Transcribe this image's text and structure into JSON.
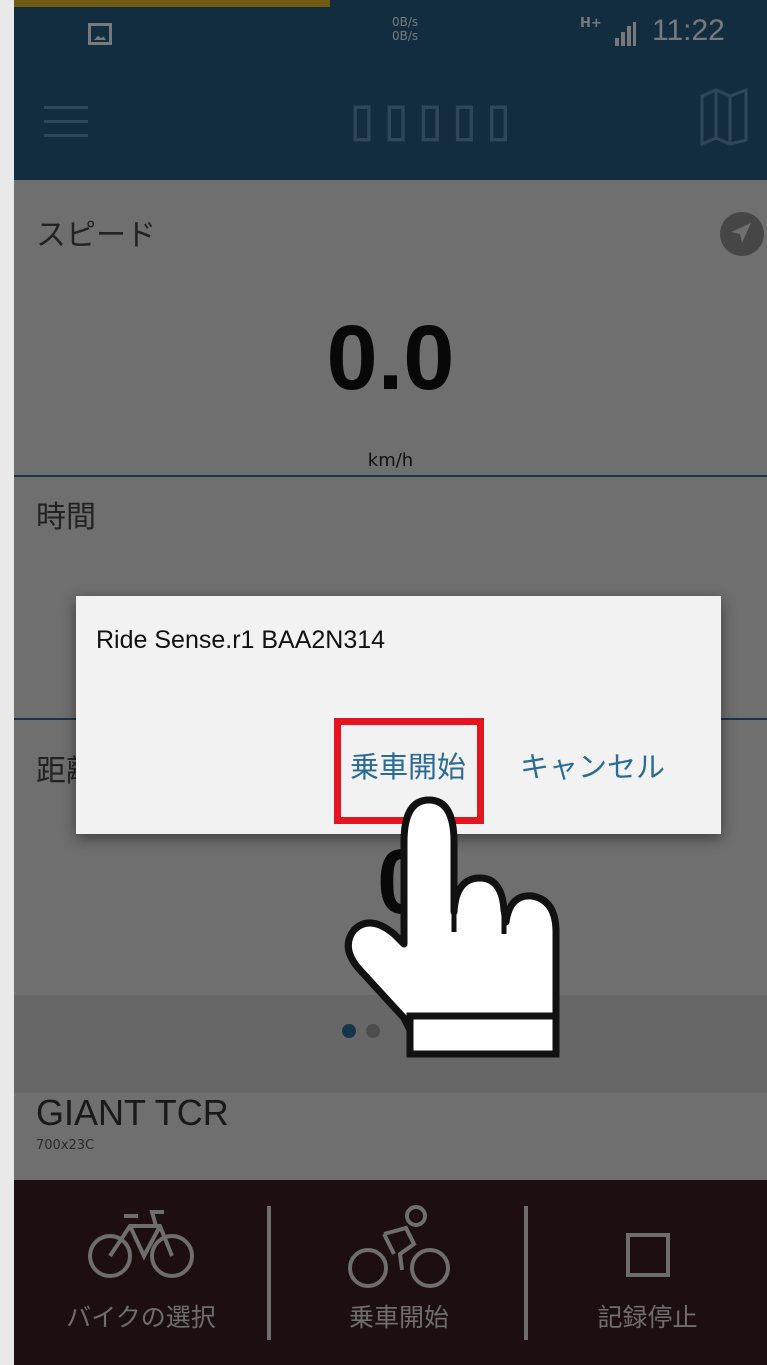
{
  "status_bar": {
    "net_up": "0B/s",
    "net_down": "0B/s",
    "network_type": "H+",
    "time": "11:22"
  },
  "app_bar": {
    "title": "▯▯▯▯▯"
  },
  "speed": {
    "label": "スピード",
    "value": "0.0",
    "unit": "km/h"
  },
  "time_section": {
    "label": "時間"
  },
  "distance": {
    "label": "距離",
    "value": "0"
  },
  "bike": {
    "name": "GIANT TCR",
    "tire": "700x23C"
  },
  "bottom_nav": {
    "items": [
      {
        "label": "バイクの選択",
        "icon": "bicycle-icon"
      },
      {
        "label": "乗車開始",
        "icon": "cyclist-icon"
      },
      {
        "label": "記録停止",
        "icon": "stop-icon"
      }
    ]
  },
  "dialog": {
    "title": "Ride Sense.r1 BAA2N314",
    "confirm_label": "乗車開始",
    "cancel_label": "キャンセル"
  },
  "colors": {
    "primary": "#245a7e",
    "accent_text": "#2b6b93",
    "highlight": "#e3151e",
    "bottom_bar": "#3a1f20"
  }
}
